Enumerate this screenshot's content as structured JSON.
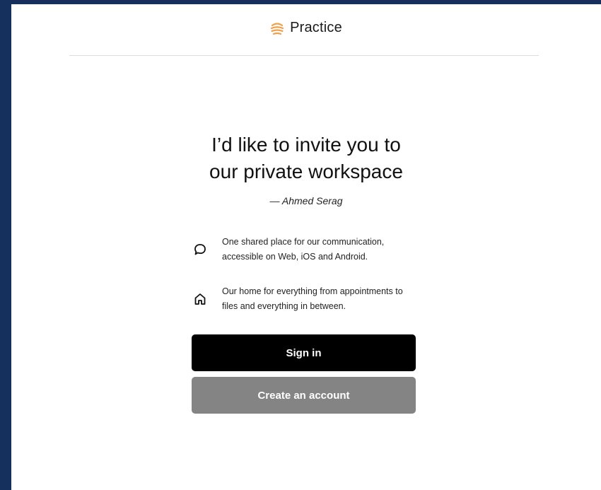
{
  "brand": {
    "logo_icon": "sun-stripes-icon",
    "name": "Practice",
    "logo_color": "#f0a04b"
  },
  "invite": {
    "headline_line1": "I’d like to invite you to",
    "headline_line2": "our private workspace",
    "attribution": "— Ahmed Serag"
  },
  "features": [
    {
      "icon": "chat-bubble-icon",
      "line1": "One shared place for our communication,",
      "line2": "accessible on Web, iOS and Android."
    },
    {
      "icon": "home-icon",
      "line1": "Our home for everything from appointments to",
      "line2": "files and everything in between."
    }
  ],
  "actions": {
    "sign_in_label": "Sign in",
    "create_account_label": "Create an account"
  },
  "colors": {
    "background": "#16305e",
    "primary_button": "#000000",
    "secondary_button": "#848484"
  }
}
